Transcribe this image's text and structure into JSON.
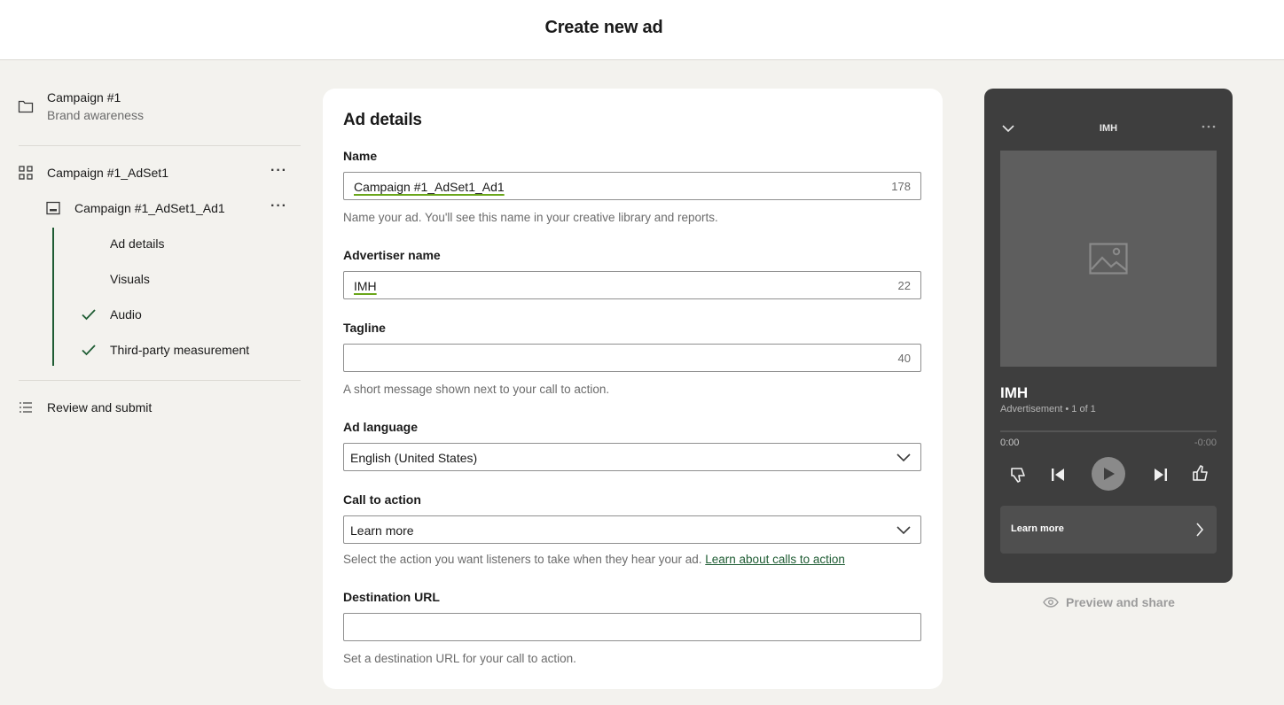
{
  "header": {
    "title": "Create new ad"
  },
  "sidebar": {
    "campaign": {
      "name": "Campaign #1",
      "objective": "Brand awareness"
    },
    "adset": {
      "name": "Campaign #1_AdSet1",
      "more_label": "···"
    },
    "ad": {
      "name": "Campaign #1_AdSet1_Ad1",
      "more_label": "···"
    },
    "steps": [
      {
        "label": "Ad details",
        "completed": false
      },
      {
        "label": "Visuals",
        "completed": false
      },
      {
        "label": "Audio",
        "completed": true
      },
      {
        "label": "Third-party measurement",
        "completed": true
      }
    ],
    "review": "Review and submit"
  },
  "form": {
    "heading": "Ad details",
    "name": {
      "label": "Name",
      "value": "Campaign #1_AdSet1_Ad1",
      "remaining": "178",
      "help": "Name your ad. You'll see this name in your creative library and reports."
    },
    "advertiser": {
      "label": "Advertiser name",
      "value": "IMH",
      "remaining": "22"
    },
    "tagline": {
      "label": "Tagline",
      "value": "",
      "remaining": "40",
      "help": "A short message shown next to your call to action."
    },
    "language": {
      "label": "Ad language",
      "value": "English (United States)"
    },
    "cta": {
      "label": "Call to action",
      "value": "Learn more",
      "help": "Select the action you want listeners to take when they hear your ad.",
      "link": "Learn about calls to action"
    },
    "url": {
      "label": "Destination URL",
      "value": "",
      "help": "Set a destination URL for your call to action."
    }
  },
  "preview": {
    "header": "IMH",
    "name": "IMH",
    "subtitle": "Advertisement • 1 of 1",
    "time_elapsed": "0:00",
    "time_remaining": "-0:00",
    "cta_label": "Learn more",
    "share_label": "Preview and share"
  },
  "colors": {
    "accent_green": "#1e5c33",
    "underline_green": "#6aa61a",
    "phone_bg": "#3e3e3e"
  }
}
